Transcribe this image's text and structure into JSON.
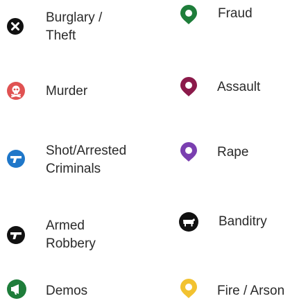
{
  "legend": {
    "items": [
      {
        "id": "burglary",
        "label_line1": "Burglary /",
        "label_line2": "Theft",
        "icon": "x-circle-icon",
        "color": "#111111"
      },
      {
        "id": "fraud",
        "label": "Fraud",
        "icon": "map-pin-icon",
        "color": "#1e7d3a"
      },
      {
        "id": "murder",
        "label": "Murder",
        "icon": "skull-icon",
        "color": "#e05252"
      },
      {
        "id": "assault",
        "label": "Assault",
        "icon": "map-pin-icon",
        "color": "#8b1a4a"
      },
      {
        "id": "shot",
        "label_line1": "Shot/Arrested",
        "label_line2": "Criminals",
        "icon": "gun-icon",
        "color": "#1f77c9"
      },
      {
        "id": "rape",
        "label": "Rape",
        "icon": "map-pin-icon",
        "color": "#7a3fb0"
      },
      {
        "id": "armed",
        "label_line1": "Armed",
        "label_line2": "Robbery",
        "icon": "gun-icon",
        "color": "#111111"
      },
      {
        "id": "banditry",
        "label": "Banditry",
        "icon": "cow-icon",
        "color": "#111111"
      },
      {
        "id": "demos",
        "label": "Demos",
        "icon": "megaphone-icon",
        "color": "#1e7d3a"
      },
      {
        "id": "fire",
        "label": "Fire / Arson",
        "icon": "map-pin-icon",
        "color": "#f2c230"
      }
    ]
  }
}
